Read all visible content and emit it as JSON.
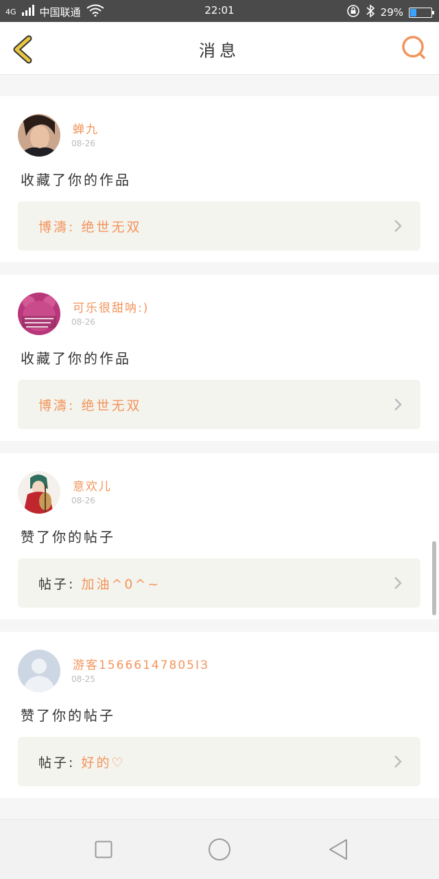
{
  "status_bar": {
    "network": "4G",
    "carrier": "中国联通",
    "time": "22:01",
    "battery": "29%",
    "battery_level": 0.29
  },
  "header": {
    "title": "消息",
    "back_icon": "chevron-left-icon",
    "search_icon": "search-icon"
  },
  "messages": [
    {
      "name": "蝉九",
      "date": "08-26",
      "action": "收藏了你的作品",
      "ref_prefix": "博濤:",
      "ref_body": "绝世无双"
    },
    {
      "name": "可乐很甜呐:)",
      "date": "08-26",
      "action": "收藏了你的作品",
      "ref_prefix": "博濤:",
      "ref_body": "绝世无双"
    },
    {
      "name": "意欢儿",
      "date": "08-26",
      "action": "赞了你的帖子",
      "ref_prefix": "帖子:",
      "ref_body": "加油^0^~"
    },
    {
      "name": "游客15666147805ⅠЗ",
      "date": "08-25",
      "action": "赞了你的帖子",
      "ref_prefix": "帖子:",
      "ref_body": "好的♡"
    }
  ],
  "colors": {
    "accent": "#f2945b",
    "back_yellow": "#e9c642"
  }
}
